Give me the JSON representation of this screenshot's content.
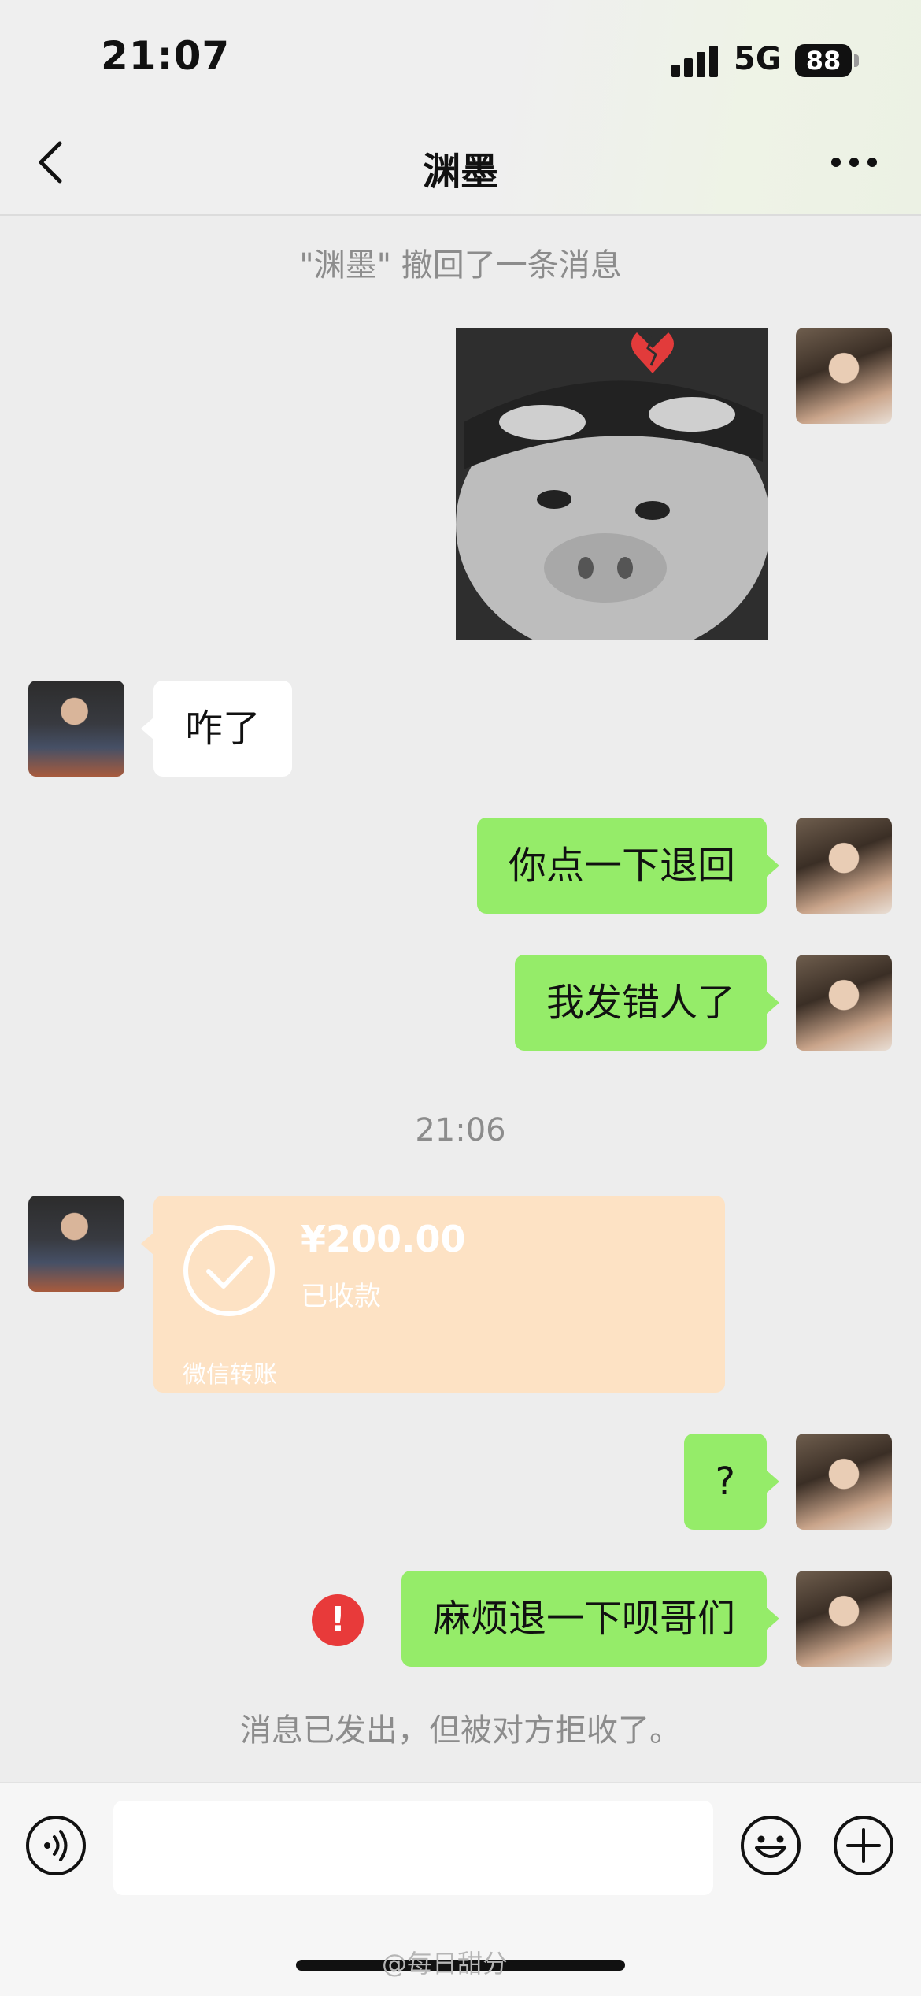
{
  "status_bar": {
    "time": "21:07",
    "network": "5G",
    "battery": "88"
  },
  "header": {
    "title": "渊墨"
  },
  "messages": {
    "recall_notice": "\"渊墨\" 撤回了一条消息",
    "him_1": "咋了",
    "me_1": "你点一下退回",
    "me_2": "我发错人了",
    "time_divider": "21:06",
    "transfer": {
      "amount": "¥200.00",
      "status": "已收款",
      "label": "微信转账"
    },
    "me_3": "?",
    "me_4": "麻烦退一下呗哥们",
    "rejected_notice": "消息已发出，但被对方拒收了。",
    "error_mark": "!"
  },
  "watermark": "@每日甜分"
}
